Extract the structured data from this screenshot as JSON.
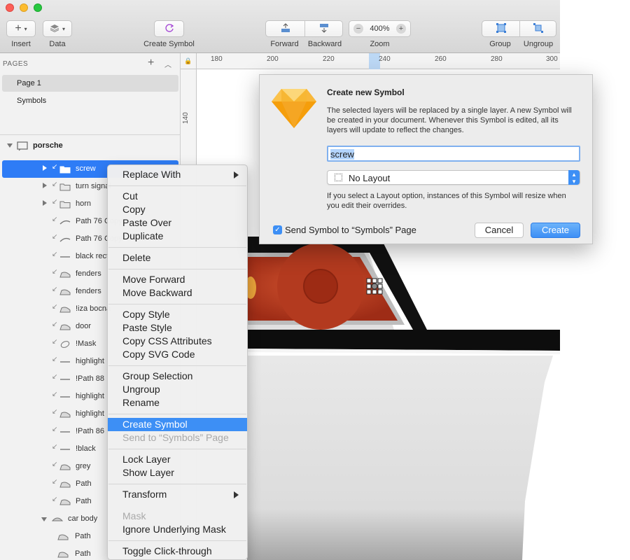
{
  "toolbar": {
    "insert_label": "Insert",
    "data_label": "Data",
    "create_symbol_label": "Create Symbol",
    "forward_label": "Forward",
    "backward_label": "Backward",
    "zoom_label": "Zoom",
    "zoom_value": "400%",
    "zoom_out": "−",
    "zoom_in": "+",
    "group_label": "Group",
    "ungroup_label": "Ungroup"
  },
  "sidebar": {
    "pages_header": "PAGES",
    "add_page": "+",
    "pages": [
      {
        "label": "Page 1",
        "selected": true
      },
      {
        "label": "Symbols",
        "selected": false
      }
    ],
    "artboard": "porsche",
    "layers": [
      {
        "name": "screw",
        "type": "folder",
        "selected": true
      },
      {
        "name": "turn signal",
        "type": "folder"
      },
      {
        "name": "horn",
        "type": "folder"
      },
      {
        "name": "Path 76 Copy",
        "type": "path"
      },
      {
        "name": "Path 76 Copy",
        "type": "path"
      },
      {
        "name": "black rect",
        "type": "line"
      },
      {
        "name": "fenders",
        "type": "shape"
      },
      {
        "name": "fenders",
        "type": "shape"
      },
      {
        "name": "!iza bocna",
        "type": "shape"
      },
      {
        "name": "door",
        "type": "shape"
      },
      {
        "name": "!Mask",
        "type": "oval"
      },
      {
        "name": "highlight",
        "type": "line"
      },
      {
        "name": "!Path 88",
        "type": "line"
      },
      {
        "name": "highlight",
        "type": "line"
      },
      {
        "name": "highlight",
        "type": "shape"
      },
      {
        "name": "!Path 86",
        "type": "line"
      },
      {
        "name": "!black",
        "type": "line"
      },
      {
        "name": "grey",
        "type": "shape"
      },
      {
        "name": "Path",
        "type": "shape"
      },
      {
        "name": "Path",
        "type": "shape"
      },
      {
        "name": "car body",
        "type": "group"
      },
      {
        "name": "Path",
        "type": "shape"
      },
      {
        "name": "Path",
        "type": "shape"
      }
    ]
  },
  "ruler": {
    "h_ticks": [
      "180",
      "200",
      "220",
      "240",
      "260",
      "280",
      "300"
    ],
    "v_ticks": [
      "140"
    ]
  },
  "context_menu": {
    "items": [
      {
        "label": "Replace With",
        "submenu": true
      },
      {
        "label": "Cut"
      },
      {
        "label": "Copy"
      },
      {
        "label": "Paste Over"
      },
      {
        "label": "Duplicate"
      },
      {
        "label": "Delete"
      },
      {
        "label": "Move Forward"
      },
      {
        "label": "Move Backward"
      },
      {
        "label": "Copy Style"
      },
      {
        "label": "Paste Style"
      },
      {
        "label": "Copy CSS Attributes"
      },
      {
        "label": "Copy SVG Code"
      },
      {
        "label": "Group Selection"
      },
      {
        "label": "Ungroup"
      },
      {
        "label": "Rename"
      },
      {
        "label": "Create Symbol",
        "highlighted": true
      },
      {
        "label": "Send to “Symbols” Page",
        "disabled": true
      },
      {
        "label": "Lock Layer"
      },
      {
        "label": "Show Layer"
      },
      {
        "label": "Transform",
        "submenu": true
      },
      {
        "label": "Mask",
        "disabled": true
      },
      {
        "label": "Ignore Underlying Mask"
      },
      {
        "label": "Toggle Click-through"
      }
    ]
  },
  "dialog": {
    "title": "Create new Symbol",
    "description": "The selected layers will be replaced by a single layer. A new Symbol will be created in your document. Whenever this Symbol is edited, all its layers will update to reflect the changes.",
    "name_value": "screw",
    "layout_value": "No Layout",
    "layout_help": "If you select a Layout option, instances of this Symbol will resize when you edit their overrides.",
    "send_checkbox_label": "Send Symbol to “Symbols” Page",
    "send_checked": true,
    "cancel_label": "Cancel",
    "create_label": "Create"
  },
  "colors": {
    "accent": "#3d8ff5",
    "selection": "#2e7cf6",
    "car_red": "#c43d22",
    "car_black": "#111111"
  }
}
